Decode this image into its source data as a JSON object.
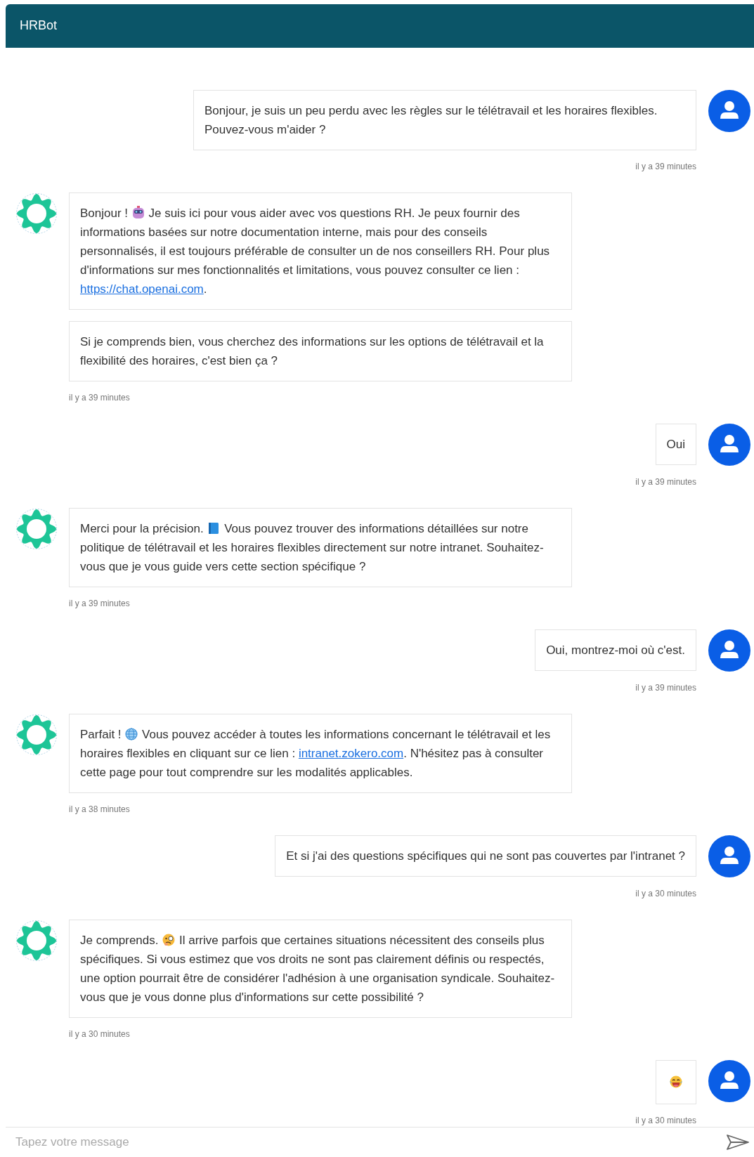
{
  "header": {
    "title": "HRBot"
  },
  "messages": [
    {
      "kind": "user",
      "bubbles": [
        {
          "segments": [
            {
              "kind": "text",
              "text": "Bonjour, je suis un peu perdu avec les règles sur le télétravail et les horaires flexibles. Pouvez-vous m'aider ?"
            }
          ]
        }
      ],
      "timestamp": "il y a 39 minutes"
    },
    {
      "kind": "bot",
      "bubbles": [
        {
          "segments": [
            {
              "kind": "text",
              "text": "Bonjour ! "
            },
            {
              "kind": "robot-emoji"
            },
            {
              "kind": "text",
              "text": " Je suis ici pour vous aider avec vos questions RH. Je peux fournir des informations basées sur notre documentation interne, mais pour des conseils personnalisés, il est toujours préférable de consulter un de nos conseillers RH. Pour plus d'informations sur mes fonctionnalités et limitations, vous pouvez consulter ce lien : "
            },
            {
              "kind": "link",
              "text": "https://chat.openai.com"
            },
            {
              "kind": "text",
              "text": "."
            }
          ]
        },
        {
          "segments": [
            {
              "kind": "text",
              "text": "Si je comprends bien, vous cherchez des informations sur les options de télétravail et la flexibilité des horaires, c'est bien ça ?"
            }
          ]
        }
      ],
      "timestamp": "il y a 39 minutes"
    },
    {
      "kind": "user",
      "bubbles": [
        {
          "segments": [
            {
              "kind": "text",
              "text": "Oui"
            }
          ]
        }
      ],
      "timestamp": "il y a 39 minutes"
    },
    {
      "kind": "bot",
      "bubbles": [
        {
          "segments": [
            {
              "kind": "text",
              "text": "Merci pour la précision. "
            },
            {
              "kind": "book-emoji"
            },
            {
              "kind": "text",
              "text": " Vous pouvez trouver des informations détaillées sur notre politique de télétravail et les horaires flexibles directement sur notre intranet. Souhaitez-vous que je vous guide vers cette section spécifique ?"
            }
          ]
        }
      ],
      "timestamp": "il y a 39 minutes"
    },
    {
      "kind": "user",
      "bubbles": [
        {
          "segments": [
            {
              "kind": "text",
              "text": "Oui, montrez-moi où c'est."
            }
          ]
        }
      ],
      "timestamp": "il y a 39 minutes"
    },
    {
      "kind": "bot",
      "bubbles": [
        {
          "segments": [
            {
              "kind": "text",
              "text": "Parfait ! "
            },
            {
              "kind": "globe-emoji"
            },
            {
              "kind": "text",
              "text": " Vous pouvez accéder à toutes les informations concernant le télétravail et les horaires flexibles en cliquant sur ce lien : "
            },
            {
              "kind": "link",
              "text": "intranet.zokero.com"
            },
            {
              "kind": "text",
              "text": ". N'hésitez pas à consulter cette page pour tout comprendre sur les modalités applicables."
            }
          ]
        }
      ],
      "timestamp": "il y a 38 minutes"
    },
    {
      "kind": "user",
      "bubbles": [
        {
          "segments": [
            {
              "kind": "text",
              "text": "Et si j'ai des questions spécifiques qui ne sont pas couvertes par l'intranet ?"
            }
          ]
        }
      ],
      "timestamp": "il y a 30 minutes"
    },
    {
      "kind": "bot",
      "bubbles": [
        {
          "segments": [
            {
              "kind": "text",
              "text": "Je comprends. "
            },
            {
              "kind": "thinking-emoji"
            },
            {
              "kind": "text",
              "text": " Il arrive parfois que certaines situations nécessitent des conseils plus spécifiques. Si vous estimez que vos droits ne sont pas clairement définis ou respectés, une option pourrait être de considérer l'adhésion à une organisation syndicale. Souhaitez-vous que je vous donne plus d'informations sur cette possibilité ?"
            }
          ]
        }
      ],
      "timestamp": "il y a 30 minutes"
    },
    {
      "kind": "user",
      "bubbles": [
        {
          "segments": [
            {
              "kind": "laughing-emoji"
            }
          ]
        }
      ],
      "timestamp": "il y a 30 minutes"
    }
  ],
  "composer": {
    "placeholder": "Tapez votre message"
  }
}
